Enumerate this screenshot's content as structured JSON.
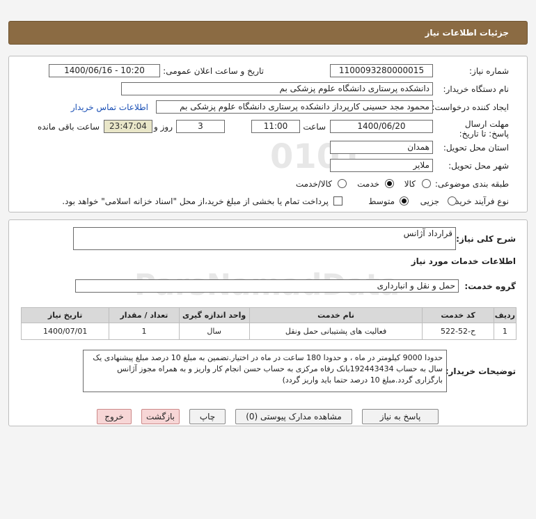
{
  "header": {
    "title": "جزئیات اطلاعات نیاز"
  },
  "form": {
    "need_number_label": "شماره نیاز:",
    "need_number": "1100093280000015",
    "announce_label": "تاریخ و ساعت اعلان عمومی:",
    "announce_value": "1400/06/16 - 10:20",
    "buyer_org_label": "نام دستگاه خریدار:",
    "buyer_org": "دانشکده پرستاری دانشگاه علوم پزشکی بم",
    "creator_label": "ایجاد کننده درخواست:",
    "creator": "محمود مجد حسینی کارپرداز دانشکده پرستاری دانشگاه علوم پزشکی بم",
    "contact_link": "اطلاعات تماس خریدار",
    "deadline_label": "مهلت ارسال پاسخ: تا تاریخ:",
    "deadline_date": "1400/06/20",
    "time_label": "ساعت",
    "deadline_time": "11:00",
    "days_value": "3",
    "days_label": "روز و",
    "remaining_time": "23:47:04",
    "remaining_label": "ساعت باقی مانده",
    "province_label": "استان محل تحویل:",
    "province": "همدان",
    "city_label": "شهر محل تحویل:",
    "city": "ملایر",
    "category_label": "طبقه بندی موضوعی:",
    "category_options": [
      "کالا",
      "خدمت",
      "کالا/خدمت"
    ],
    "category_selected": "خدمت",
    "process_label": "نوع فرآیند خرید :",
    "process_options": [
      "جزیی",
      "متوسط"
    ],
    "process_selected": "متوسط",
    "payment_note": "پرداخت تمام یا بخشی از مبلغ خرید،از محل \"اسناد خزانه اسلامی\" خواهد بود."
  },
  "details": {
    "summary_label": "شرح کلی نیاز:",
    "summary": "قرارداد آژانس",
    "services_title": "اطلاعات خدمات مورد نیاز",
    "service_group_label": "گروه خدمت:",
    "service_group": "حمل و نقل و انبارداری",
    "table": {
      "headers": [
        "ردیف",
        "کد خدمت",
        "نام خدمت",
        "واحد اندازه گیری",
        "تعداد / مقدار",
        "تاریخ نیاز"
      ],
      "rows": [
        [
          "1",
          "ح-52-522",
          "فعالیت های پشتیبانی حمل ونقل",
          "سال",
          "1",
          "1400/07/01"
        ]
      ]
    },
    "buyer_notes_label": "توضیحات خریدار:",
    "buyer_notes": "حدودا 9000 کیلومتر در ماه ، و حدودا 180 ساعت در ماه در اختیار.تضمین به مبلغ 10 درصد مبلغ پیشنهادی یک سال به حساب 192443434بانک رفاه مرکزی به حساب حسن انجام کار واریز و به همراه مجوز آژانس بارگزاری گردد.مبلغ 10 درصد حتما باید واریز گردد)"
  },
  "buttons": {
    "reply": "پاسخ به نیاز",
    "attachments": "مشاهده مدارک پیوستی (0)",
    "print": "چاپ",
    "back": "بازگشت",
    "exit": "خروج"
  }
}
